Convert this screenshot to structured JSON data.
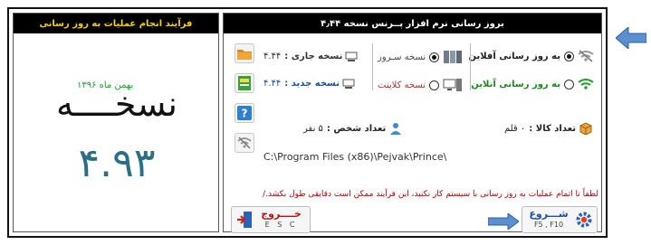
{
  "left_panel": {
    "title": "فرآیند انجام عملیات به روز رسانی",
    "version_word": "نسخــــه",
    "version_date": "بهمن ماه ۱۳۹۶",
    "version_digits": [
      "۴",
      ".",
      "۹",
      "۳"
    ]
  },
  "right_panel": {
    "title": "بروز رسانی نرم افزار پــرنس نسخه ۴٫۴۴",
    "offline_label": "به روز رسانی آفلاین",
    "online_label": "به روز رسانی آنلاین",
    "server_label": "نسخه سـرور",
    "client_label": "نسخه کلاینت",
    "current_version_label": "نسخه جاری :",
    "current_version_value": "۴.۴۴",
    "new_version_label": "نسخه جدید :",
    "new_version_value": "۴.۴۴",
    "goods_count_label": "تعداد کالا :",
    "goods_count_value": "۰ قلم",
    "persons_count_label": "تعداد شخص :",
    "persons_count_value": "۵ نفر",
    "install_path": "C:\\Program Files (x86)\\Pejvak\\Prince\\",
    "notice": "لطفاً تا اتمام عملیات به روز رسانی با سیستم کار نکنید، این فرآیند ممکن است دقایقی طول بکشد./",
    "start_button": {
      "label": "شـــروع",
      "shortcut": "F5 , F10"
    },
    "exit_button": {
      "label": "خــــروج",
      "shortcut": "E S C"
    }
  },
  "colors": {
    "title_bar": "#000000",
    "left_title_text": "#f5d000",
    "version_digits": "#2a6f86",
    "version_date": "#1aa02a",
    "online_text": "#1a8a1a",
    "new_version_text": "#1f4fa8",
    "notice_text": "#b00000",
    "arrow": "#4a86c8"
  }
}
